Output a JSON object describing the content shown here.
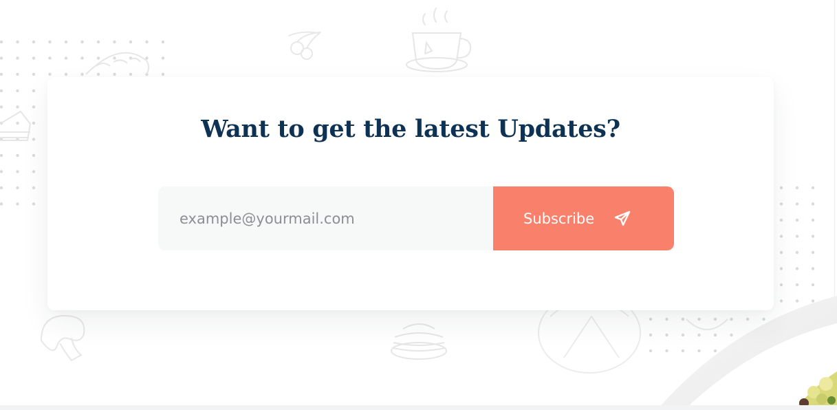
{
  "newsletter": {
    "title": "Want to get the latest Updates?",
    "email_placeholder": "example@yourmail.com",
    "email_value": "",
    "subscribe_label": "Subscribe",
    "send_icon": "paper-plane-icon"
  },
  "colors": {
    "title": "#0d3253",
    "button": "#f9806b",
    "input_bg": "#f7f8f8",
    "doodle": "#ececec",
    "dots": "#d9dadc"
  }
}
